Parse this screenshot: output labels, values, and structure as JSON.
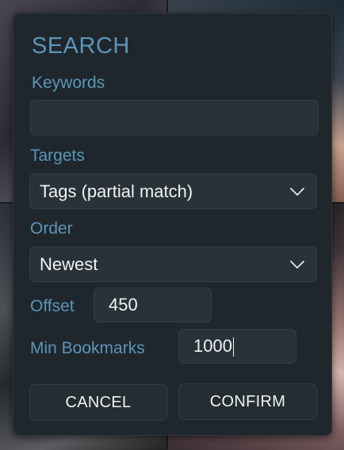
{
  "dialog": {
    "title": "SEARCH",
    "keywords": {
      "label": "Keywords",
      "value": ""
    },
    "targets": {
      "label": "Targets",
      "selected": "Tags (partial match)"
    },
    "order": {
      "label": "Order",
      "selected": "Newest"
    },
    "offset": {
      "label": "Offset",
      "value": "450"
    },
    "min_bookmarks": {
      "label": "Min Bookmarks",
      "value": "1000"
    },
    "buttons": {
      "cancel": "CANCEL",
      "confirm": "CONFIRM"
    }
  },
  "colors": {
    "accent": "#5b95b9",
    "panel": "#1f272c",
    "field": "#283238",
    "text": "#f2f2f2"
  },
  "icons": {
    "dropdown": "chevron-down-icon"
  }
}
